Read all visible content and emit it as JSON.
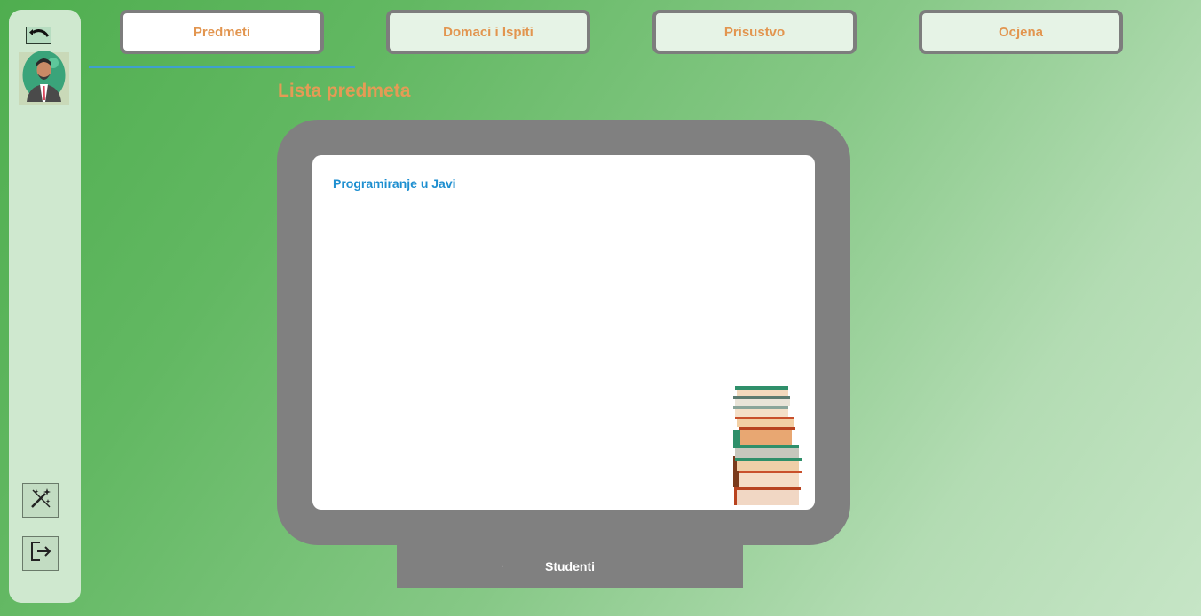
{
  "sidebar": {
    "back_icon": "undo-arrow-icon",
    "avatar_icon": "user-avatar-icon",
    "tools": [
      {
        "icon": "magic-wand-icon"
      },
      {
        "icon": "logout-icon"
      }
    ]
  },
  "tabs": [
    {
      "label": "Predmeti",
      "active": true
    },
    {
      "label": "Domaci i Ispiti",
      "active": false
    },
    {
      "label": "Prisustvo",
      "active": false
    },
    {
      "label": "Ocjena",
      "active": false
    }
  ],
  "main": {
    "title": "Lista predmeta",
    "subjects": [
      "Programiranje u Javi"
    ],
    "illustration": "books-stack-icon",
    "stand_marker": "¹",
    "stand_label": "Studenti"
  },
  "colors": {
    "accent_orange": "#e2954f",
    "subject_blue": "#1e8fd0",
    "monitor_gray": "#808080",
    "underline_blue": "#3f9fd0"
  }
}
